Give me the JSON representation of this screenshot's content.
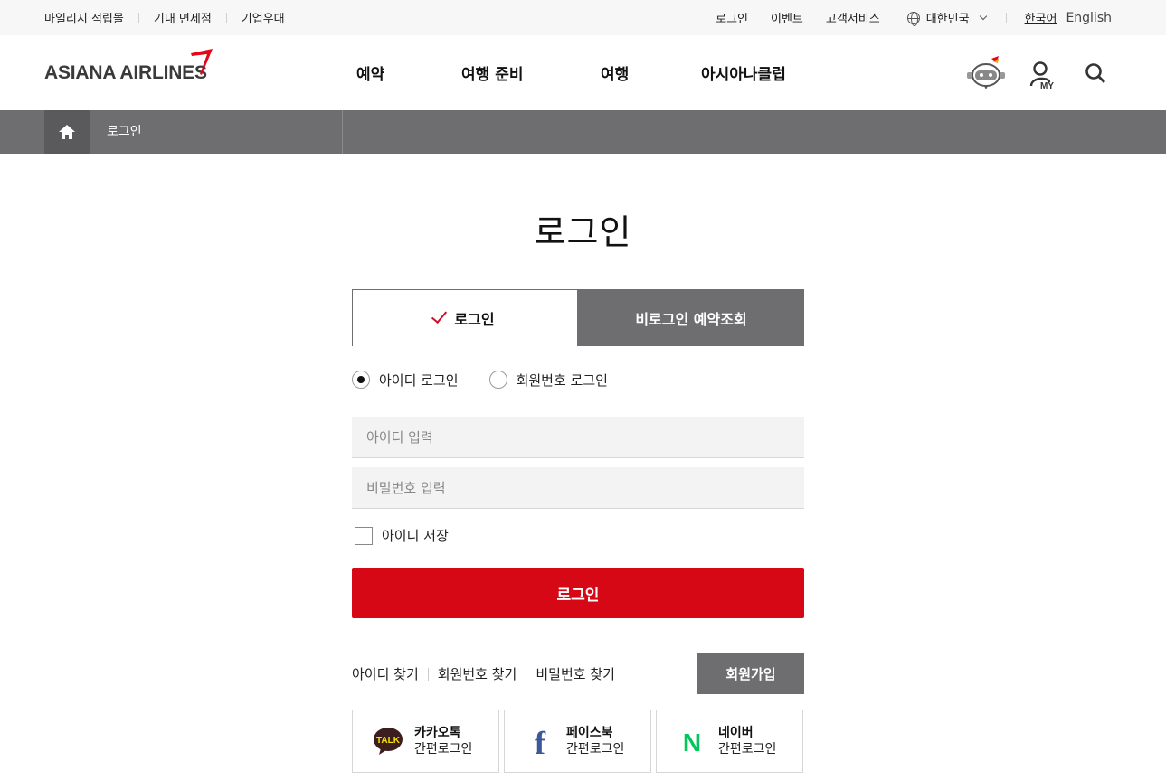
{
  "topbar": {
    "left_links": [
      "마일리지 적립몰",
      "기내 면세점",
      "기업우대"
    ],
    "right_links": [
      "로그인",
      "이벤트",
      "고객서비스"
    ],
    "country": "대한민국",
    "lang_ko": "한국어",
    "lang_en": "English"
  },
  "header": {
    "logo": "ASIANA AIRLINES",
    "nav": [
      "예약",
      "여행 준비",
      "여행",
      "아시아나클럽"
    ],
    "my_label": "MY"
  },
  "breadcrumb": {
    "current": "로그인"
  },
  "page": {
    "title": "로그인"
  },
  "tabs": {
    "login": "로그인",
    "guest": "비로그인 예약조회"
  },
  "radios": {
    "id_login": "아이디 로그인",
    "member_login": "회원번호 로그인",
    "selected": "id_login"
  },
  "form": {
    "id_placeholder": "아이디 입력",
    "pw_placeholder": "비밀번호 입력",
    "save_id": "아이디 저장",
    "submit": "로그인"
  },
  "links": {
    "find_id": "아이디 찾기",
    "find_member": "회원번호 찾기",
    "find_pw": "비밀번호 찾기",
    "join": "회원가입"
  },
  "sns": [
    {
      "name": "카카오톡",
      "sub": "간편로그인",
      "icon": "kakao-talk-icon",
      "badge": "TALK"
    },
    {
      "name": "페이스북",
      "sub": "간편로그인",
      "icon": "facebook-icon",
      "badge": "f"
    },
    {
      "name": "네이버",
      "sub": "간편로그인",
      "icon": "naver-icon",
      "badge": "N"
    }
  ],
  "colors": {
    "brand_red": "#d60815",
    "gray_bar": "#6e6e70",
    "kakao_yellow": "#f9e000",
    "facebook_blue": "#3b5998",
    "naver_green": "#03c75a"
  }
}
